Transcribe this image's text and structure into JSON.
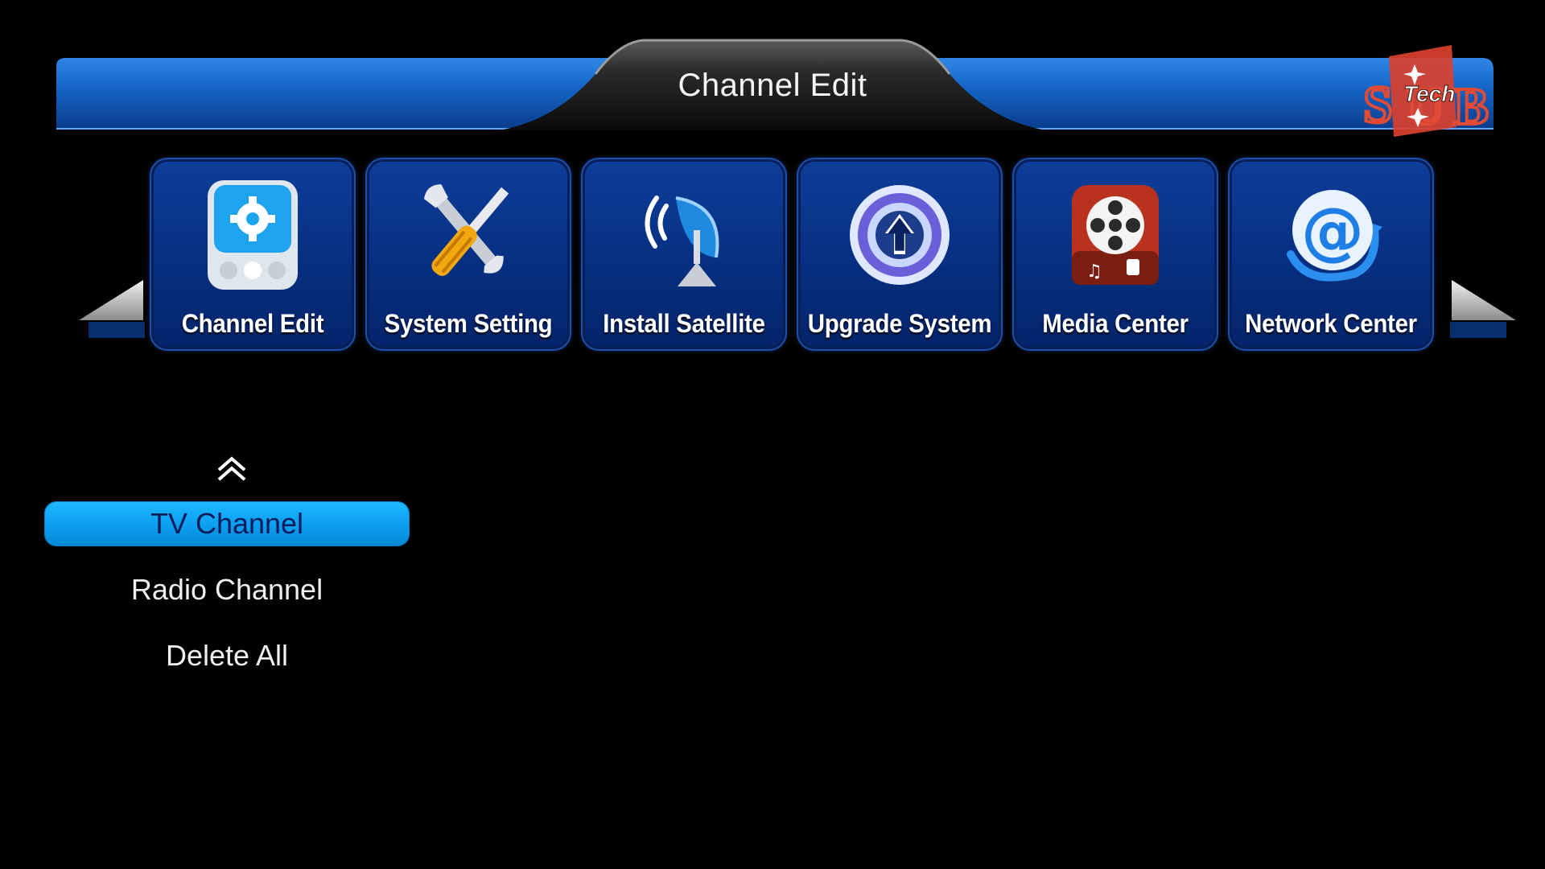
{
  "header": {
    "title": "Channel Edit"
  },
  "logo": {
    "text": "Tech",
    "letters": [
      "S",
      "U",
      "B"
    ]
  },
  "menu": {
    "items": [
      {
        "label": "Channel Edit",
        "icon": "settings-panel-icon"
      },
      {
        "label": "System Setting",
        "icon": "tools-icon"
      },
      {
        "label": "Install Satellite",
        "icon": "satellite-dish-icon"
      },
      {
        "label": "Upgrade System",
        "icon": "upgrade-arrow-icon"
      },
      {
        "label": "Media Center",
        "icon": "media-film-icon"
      },
      {
        "label": "Network Center",
        "icon": "network-at-icon"
      }
    ],
    "selected": "Channel Edit"
  },
  "submenu": {
    "items": [
      "TV Channel",
      "Radio Channel",
      "Delete All"
    ],
    "selected": "TV Channel"
  },
  "colors": {
    "band_blue": "#1565c0",
    "highlight": "#1fb8ff",
    "tile": "#062f80"
  }
}
